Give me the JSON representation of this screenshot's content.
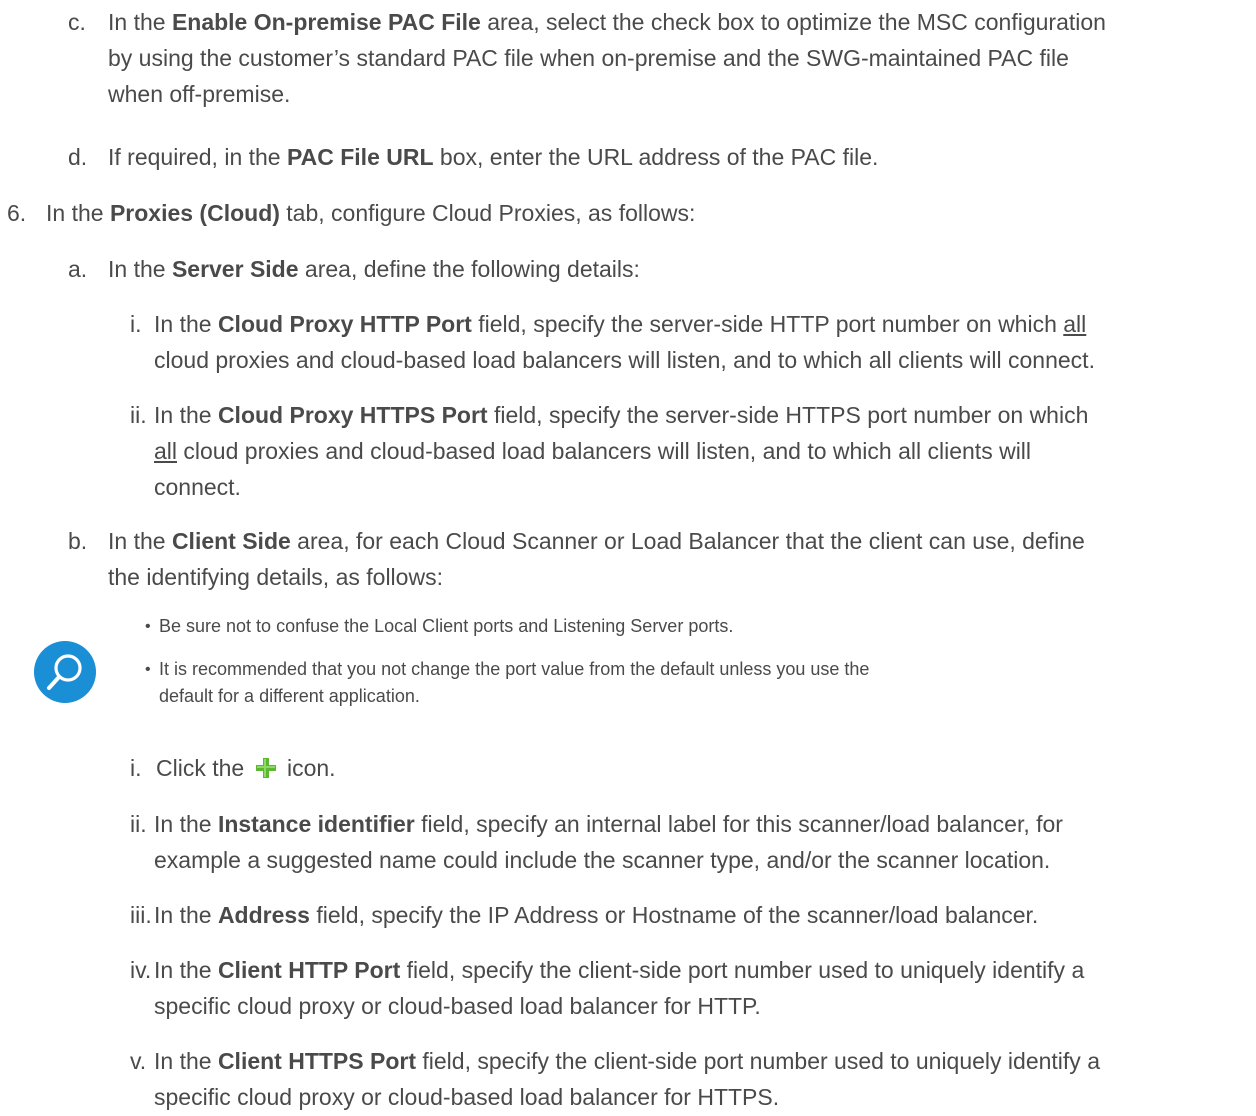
{
  "steps": {
    "c": {
      "marker": "c.",
      "prefix": "In the ",
      "bold": "Enable On-premise PAC File",
      "line1_rest": " area, select the check box to optimize the MSC configuration",
      "line2": "by using the customer’s standard PAC file when on-premise and the SWG-maintained PAC file",
      "line3": "when off-premise."
    },
    "d": {
      "marker": "d.",
      "prefix": "If required, in the ",
      "bold": "PAC File URL",
      "rest": " box, enter the URL address of the PAC file."
    },
    "six": {
      "marker": "6.",
      "prefix": "In the ",
      "bold": "Proxies (Cloud)",
      "rest": " tab, configure Cloud Proxies, as follows:"
    },
    "a": {
      "marker": "a.",
      "prefix": "In the ",
      "bold": "Server Side",
      "rest": " area, define the following details:"
    },
    "a_i": {
      "marker": "i.",
      "prefix": "In the ",
      "bold": "Cloud Proxy HTTP Port",
      "line1_mid": " field, specify the server-side HTTP port number on which ",
      "underline": "all",
      "line2": "cloud proxies and cloud-based load balancers will listen, and to which all clients will connect."
    },
    "a_ii": {
      "marker": "ii.",
      "prefix": "In the ",
      "bold": "Cloud Proxy HTTPS Port",
      "line1_rest": " field, specify the server-side HTTPS port number on which",
      "underline": "all",
      "line2_rest": " cloud proxies and cloud-based load balancers will listen, and to which all clients will",
      "line3": "connect."
    },
    "b": {
      "marker": "b.",
      "prefix": "In the ",
      "bold": "Client Side",
      "line1_rest": " area, for each Cloud Scanner or Load Balancer that the client can use, define",
      "line2": "the identifying details, as follows:"
    },
    "note": {
      "bullet": "•",
      "item1": "Be sure not to confuse the Local Client ports and Listening Server ports.",
      "item2_line1": "It is recommended that you not change the port value from the default unless you use the",
      "item2_line2": "default for a different application."
    },
    "b_i": {
      "marker": "i.",
      "prefix": "Click the",
      "icon": "green-plus-icon",
      "rest": "icon."
    },
    "b_ii": {
      "marker": "ii.",
      "prefix": "In the ",
      "bold": "Instance identifier",
      "line1_rest": " field, specify an internal label for this scanner/load balancer, for",
      "line2": "example a suggested name could include the scanner type, and/or the scanner location."
    },
    "b_iii": {
      "marker": "iii.",
      "prefix": "In the ",
      "bold": "Address",
      "rest": " field, specify the IP Address or Hostname of the scanner/load balancer."
    },
    "b_iv": {
      "marker": "iv.",
      "prefix": "In the ",
      "bold": "Client HTTP Port",
      "line1_rest": " field, specify the client-side port number used to uniquely identify a",
      "line2": "specific cloud proxy or cloud-based load balancer for HTTP."
    },
    "b_v": {
      "marker": "v.",
      "prefix": "In the ",
      "bold": "Client HTTPS Port",
      "line1_rest": " field, specify the client-side port number used to uniquely identify a",
      "line2": "specific cloud proxy or cloud-based load balancer for HTTPS."
    }
  },
  "colors": {
    "text": "#4a4a4a",
    "note_icon": "#1a8fd6",
    "plus_icon": "#5cb82e"
  }
}
